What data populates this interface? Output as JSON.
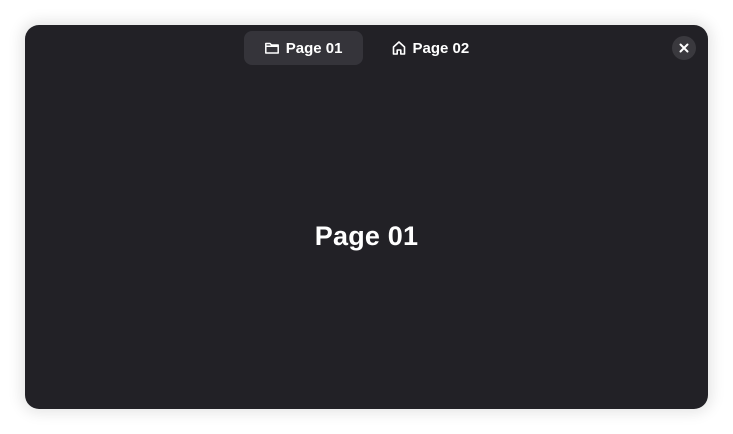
{
  "tabs": [
    {
      "label": "Page 01",
      "icon": "folder-icon",
      "active": true
    },
    {
      "label": "Page 02",
      "icon": "home-icon",
      "active": false
    }
  ],
  "close": {
    "icon": "close-icon"
  },
  "content": {
    "title": "Page 01"
  },
  "colors": {
    "window_bg": "#222126",
    "active_tab_bg": "#35343a",
    "close_bg": "#3a393e",
    "text": "#ffffff"
  }
}
